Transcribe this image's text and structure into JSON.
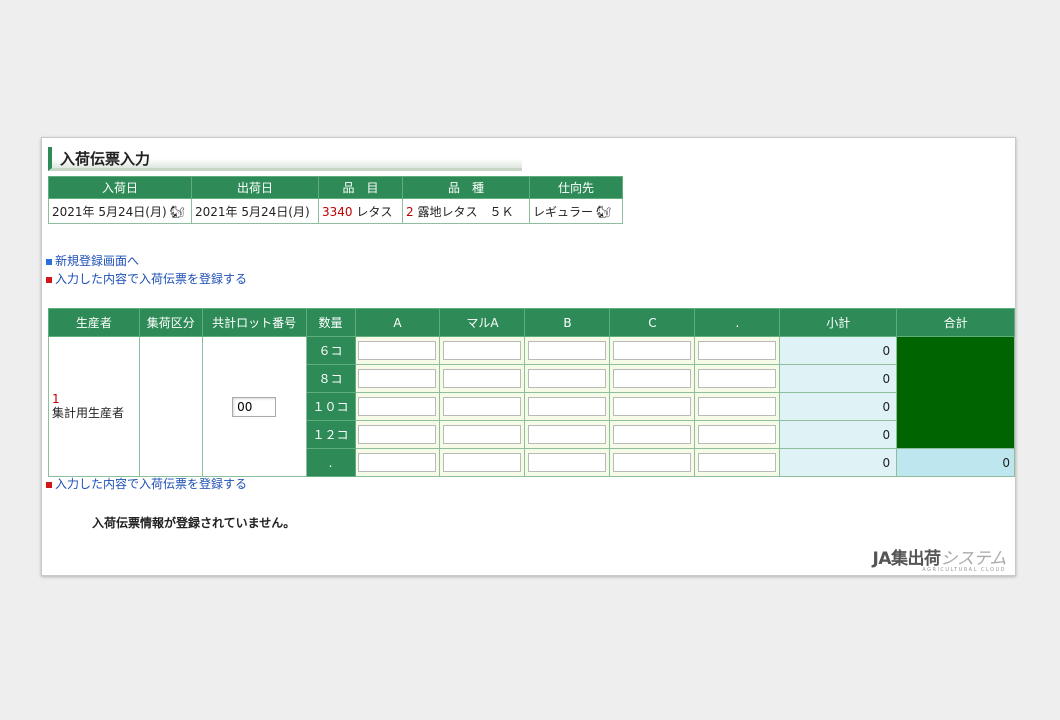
{
  "page_title": "入荷伝票入力",
  "header": {
    "columns": [
      "入荷日",
      "出荷日",
      "品　目",
      "品　種",
      "仕向先"
    ],
    "arrival_date": "2021年 5月24日(月)",
    "shipping_date": "2021年 5月24日(月)",
    "item_code": "3340",
    "item_name": "レタス",
    "variety_code": "2",
    "variety_name": "露地レタス　５Ｋ",
    "destination": "レギュラー"
  },
  "links": {
    "new_registration": "新規登録画面へ",
    "register_top": "入力した内容で入荷伝票を登録する",
    "register_bottom": "入力した内容で入荷伝票を登録する"
  },
  "grid": {
    "columns": [
      "生産者",
      "集荷区分",
      "共計ロット番号",
      "数量",
      "A",
      "マルA",
      "B",
      "C",
      ".",
      "小計",
      "合計"
    ],
    "producer_number": "1",
    "producer_name": "集計用生産者",
    "lot_number": "00",
    "rows": [
      {
        "qty": "６コ",
        "subtotal": "0"
      },
      {
        "qty": "８コ",
        "subtotal": "0"
      },
      {
        "qty": "１０コ",
        "subtotal": "0"
      },
      {
        "qty": "１２コ",
        "subtotal": "0"
      },
      {
        "qty": ".",
        "subtotal": "0"
      }
    ],
    "grand_total": "0"
  },
  "message": "入荷伝票情報が登録されていません。",
  "logo": {
    "brand": "JA集出荷",
    "suffix": "システム",
    "tagline": "AGRICULTURAL CLOUD"
  },
  "colors": {
    "header_green": "#2e8b57",
    "total_dark": "#006400",
    "link_blue": "#1e4fb5",
    "accent_red": "#c00000"
  },
  "icons": [
    "squirrel-icon",
    "blue-square-bullet-icon",
    "red-square-bullet-icon"
  ]
}
